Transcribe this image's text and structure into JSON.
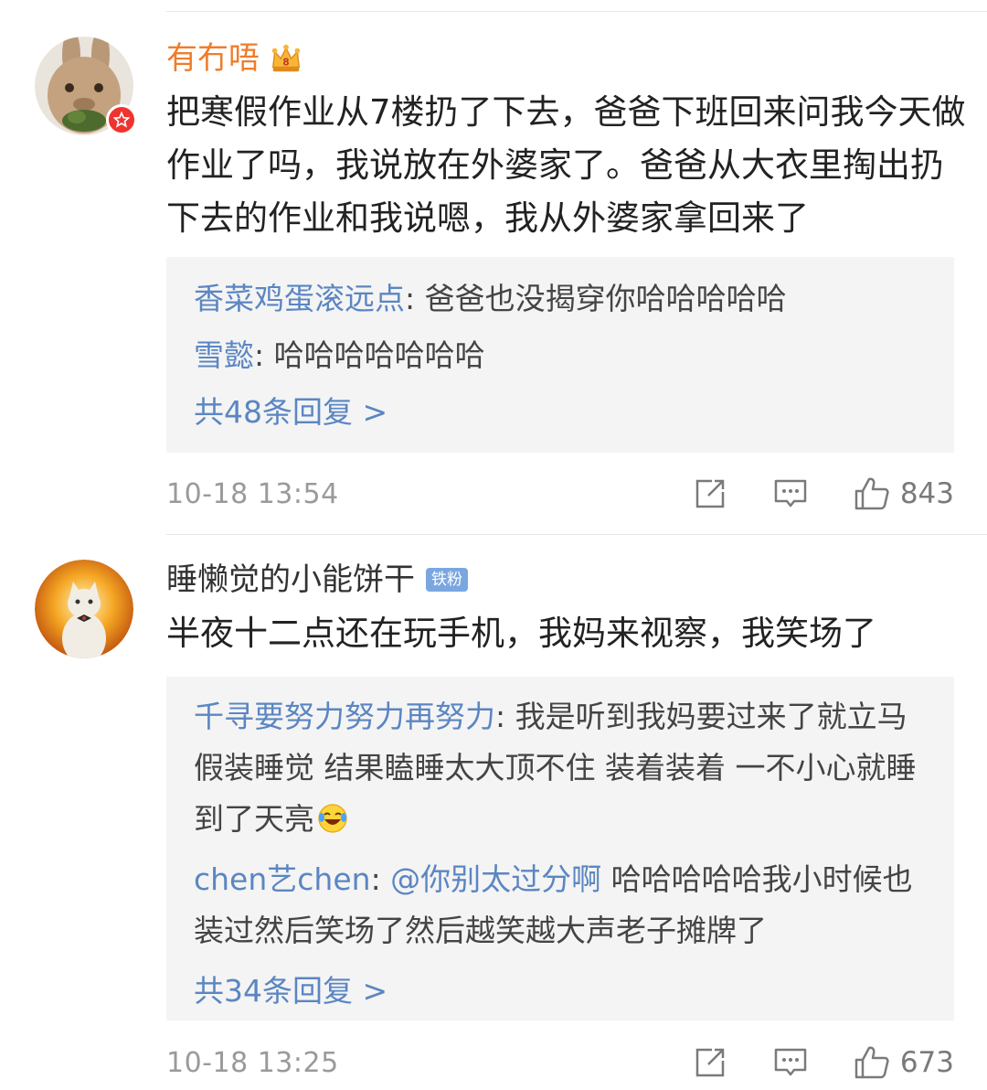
{
  "comments": [
    {
      "username": "有冇唔",
      "content": "把寒假作业从7楼扔了下去，爸爸下班回来问我今天做作业了吗，我说放在外婆家了。爸爸从大衣里掏出扔下去的作业和我说嗯，我从外婆家拿回来了",
      "replies": [
        {
          "name": "香菜鸡蛋滚远点",
          "sep": ": ",
          "text": "爸爸也没揭穿你哈哈哈哈哈"
        },
        {
          "name": "雪懿",
          "sep": ": ",
          "text": "哈哈哈哈哈哈哈"
        }
      ],
      "more_replies": "共48条回复 >",
      "time": "10-18 13:54",
      "likes": "843"
    },
    {
      "username": "睡懒觉的小能饼干",
      "badge": "铁粉",
      "content": "半夜十二点还在玩手机，我妈来视察，我笑场了",
      "replies": [
        {
          "name": "千寻要努力努力再努力",
          "sep": ": ",
          "text": "我是听到我妈要过来了就立马假装睡觉 结果瞌睡太大顶不住 装着装着 一不小心就睡到了天亮"
        },
        {
          "name": "chen艺chen",
          "sep": ": ",
          "mention": "@你别太过分啊",
          "text": " 哈哈哈哈哈我小时候也装过然后笑场了然后越笑越大声老子摊牌了"
        }
      ],
      "more_replies": "共34条回复 >",
      "time": "10-18 13:25",
      "likes": "673"
    }
  ],
  "icons": {
    "crown": "crown-icon",
    "verified": "verified-star-icon",
    "laugh": "laugh-cry-emoji-icon",
    "repost": "repost-icon",
    "comment": "comment-icon",
    "like": "like-icon"
  },
  "colors": {
    "username_vip": "#f07c2a",
    "link_blue": "#5b86c2",
    "reply_bg": "#f4f4f4",
    "timestamp": "#9a9a9a",
    "fan_badge": "#7ba7e0"
  }
}
